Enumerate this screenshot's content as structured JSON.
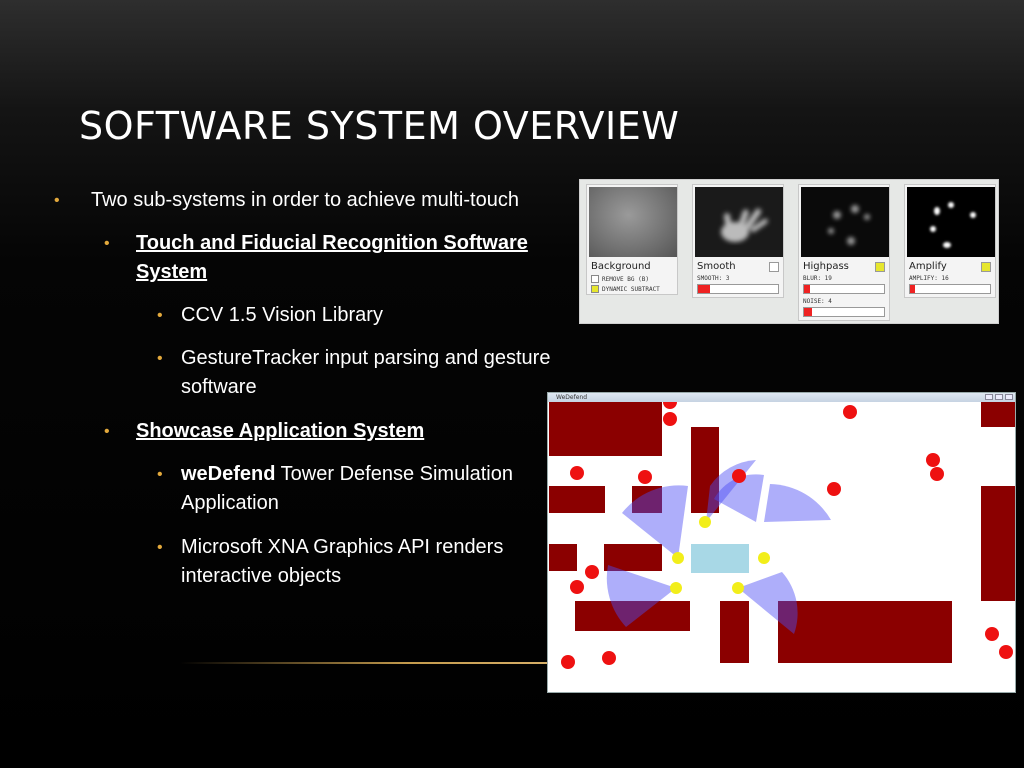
{
  "slide": {
    "title": "Software System Overview",
    "bullet_glyph": "•",
    "bullets": {
      "b1": "Two sub-systems in order to achieve multi-touch",
      "b2_l1": "Touch and Fiducial Recognition Software",
      "b2_l2": "System",
      "b3": "CCV 1.5 Vision Library",
      "b4_l1": "GestureTracker input parsing and gesture",
      "b4_l2": "software",
      "b5": "Showcase Application System",
      "b6_bold": "weDefend",
      "b6_rest": " Tower Defense Simulation",
      "b6_l2": "Application",
      "b7_l1": "Microsoft XNA Graphics API renders",
      "b7_l2": "interactive objects"
    },
    "colors": {
      "accent": "#e3a93c",
      "text": "#ffffff"
    }
  },
  "ccv": {
    "panels": [
      {
        "name": "Background",
        "toggle_on": false,
        "options": [
          {
            "label": "REMOVE BG (B)",
            "checked": false
          },
          {
            "label": "DYNAMIC SUBTRACT",
            "checked": true
          }
        ],
        "sliders": []
      },
      {
        "name": "Smooth",
        "toggle_on": false,
        "options": [],
        "sliders": [
          {
            "label": "SMOOTH: 3",
            "fill": 0.15
          }
        ]
      },
      {
        "name": "Highpass",
        "toggle_on": true,
        "options": [],
        "sliders": [
          {
            "label": "BLUR: 19",
            "fill": 0.08
          },
          {
            "label": "NOISE: 4",
            "fill": 0.1
          }
        ]
      },
      {
        "name": "Amplify",
        "toggle_on": true,
        "options": [],
        "sliders": [
          {
            "label": "AMPLIFY: 16",
            "fill": 0.06
          }
        ]
      }
    ]
  },
  "game": {
    "window_title": "WeDefend",
    "colors": {
      "wall": "#8b0000",
      "enemy": "#ee1111",
      "tower": "#f2ee1a",
      "range": "#6f6ff5",
      "base": "#a8d8e6"
    }
  }
}
